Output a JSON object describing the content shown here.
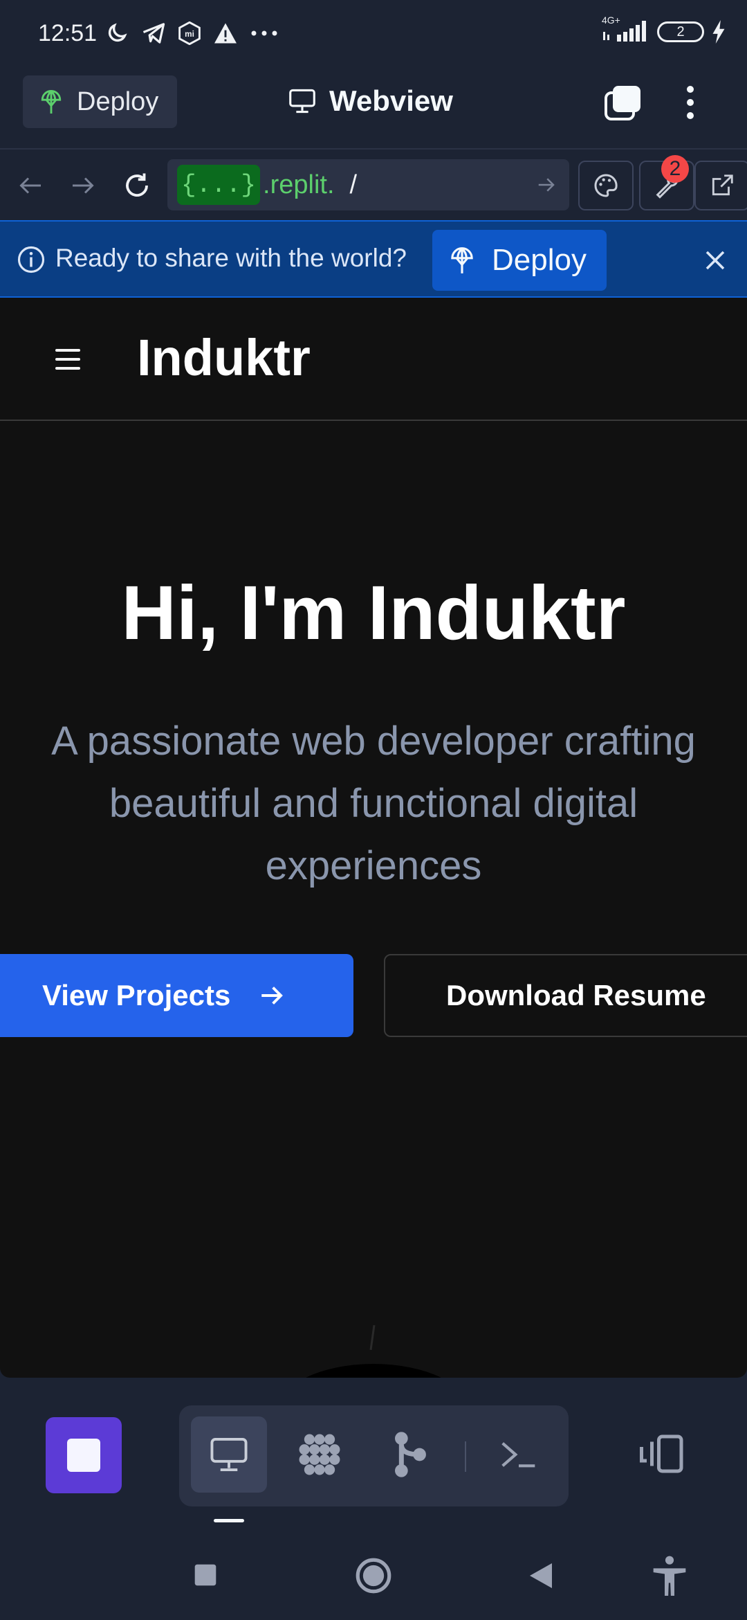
{
  "status_bar": {
    "time": "12:51",
    "network": "4G+",
    "battery": "2",
    "icons": [
      "moon-icon",
      "telegram-icon",
      "mi-icon",
      "warning-icon",
      "more-dots-icon",
      "signal-icon",
      "charging-icon"
    ]
  },
  "header": {
    "deploy_label": "Deploy",
    "title": "Webview"
  },
  "url_bar": {
    "repl_tag": "{...}",
    "domain": ".replit.",
    "path": "/",
    "devtools_badge": "2"
  },
  "banner": {
    "message": "Ready to share with the world?",
    "deploy_label": "Deploy"
  },
  "webpage": {
    "logo": "Induktr",
    "hero_title": "Hi, I'm Induktr",
    "hero_subtitle": "A passionate web developer crafting beautiful and functional digital experiences",
    "primary_button": "View Projects",
    "secondary_button": "Download Resume"
  },
  "colors": {
    "accent_blue": "#2563eb",
    "deploy_green": "#5ccf6c",
    "stop_purple": "#5c3bd6",
    "banner_bg": "#0a3e84"
  }
}
